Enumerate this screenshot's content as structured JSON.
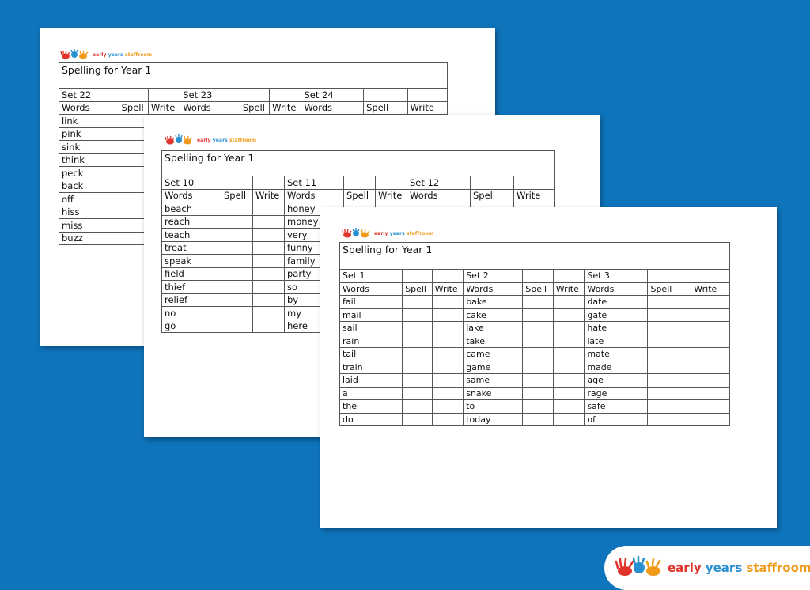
{
  "colors": {
    "background": "#0e74bb",
    "brand_red": "#e0342b",
    "brand_blue": "#2a8fd0",
    "brand_orange": "#f19a1a"
  },
  "brand": {
    "w1": "early",
    "w2": "years",
    "w3": "staffroom",
    "icon": "hands-icon"
  },
  "sheets": [
    {
      "title": "Spelling for Year 1",
      "sets": [
        "Set 22",
        "Set 23",
        "Set 24"
      ],
      "headers": [
        "Words",
        "Spell",
        "Write"
      ],
      "rows": [
        [
          "link",
          "",
          ""
        ],
        [
          "pink",
          "",
          ""
        ],
        [
          "sink",
          "",
          ""
        ],
        [
          "think",
          "",
          ""
        ],
        [
          "peck",
          "",
          ""
        ],
        [
          "back",
          "",
          ""
        ],
        [
          "off",
          "",
          ""
        ],
        [
          "hiss",
          "",
          ""
        ],
        [
          "miss",
          "",
          ""
        ],
        [
          "buzz",
          "",
          ""
        ]
      ]
    },
    {
      "title": "Spelling for Year 1",
      "sets": [
        "Set 10",
        "Set 11",
        "Set 12"
      ],
      "headers": [
        "Words",
        "Spell",
        "Write"
      ],
      "rows": [
        [
          "beach",
          "honey",
          ""
        ],
        [
          "reach",
          "money",
          ""
        ],
        [
          "teach",
          "very",
          ""
        ],
        [
          "treat",
          "funny",
          ""
        ],
        [
          "speak",
          "family",
          ""
        ],
        [
          "field",
          "party",
          ""
        ],
        [
          "thief",
          "so",
          ""
        ],
        [
          "relief",
          "by",
          ""
        ],
        [
          "no",
          "my",
          ""
        ],
        [
          "go",
          "here",
          ""
        ]
      ]
    },
    {
      "title": "Spelling for Year 1",
      "sets": [
        "Set 1",
        "Set 2",
        "Set 3"
      ],
      "headers": [
        "Words",
        "Spell",
        "Write"
      ],
      "rows": [
        [
          "fail",
          "bake",
          "date"
        ],
        [
          "mail",
          "cake",
          "gate"
        ],
        [
          "sail",
          "lake",
          "hate"
        ],
        [
          "rain",
          "take",
          "late"
        ],
        [
          "tail",
          "came",
          "mate"
        ],
        [
          "train",
          "game",
          "made"
        ],
        [
          "laid",
          "same",
          "age"
        ],
        [
          "a",
          "snake",
          "rage"
        ],
        [
          "the",
          "to",
          "safe"
        ],
        [
          "do",
          "today",
          "of"
        ]
      ]
    }
  ]
}
